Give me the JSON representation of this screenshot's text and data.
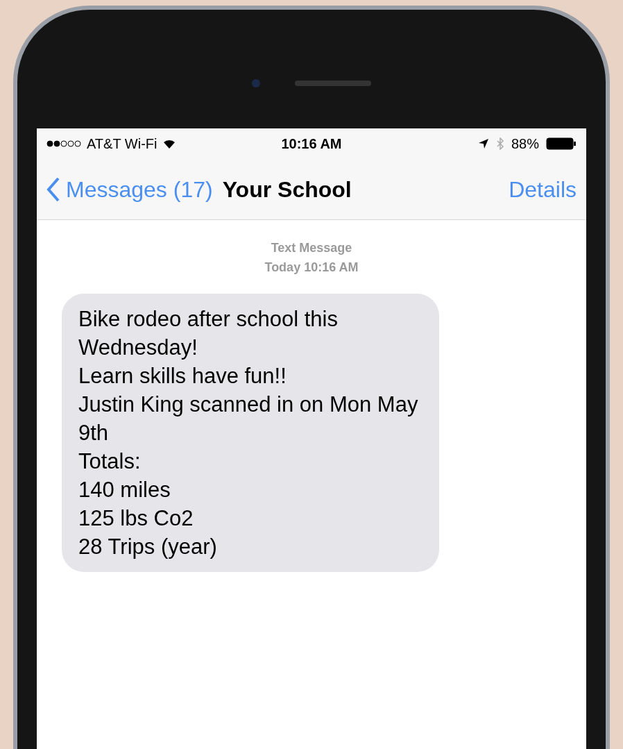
{
  "status_bar": {
    "carrier": "AT&T Wi-Fi",
    "time": "10:16 AM",
    "battery": "88%"
  },
  "nav": {
    "back": "Messages (17)",
    "title": "Your School",
    "action": "Details"
  },
  "thread": {
    "header": "Text Message",
    "timestamp": "Today 10:16 AM",
    "messages": [
      {
        "lines": [
          "Bike rodeo after school this Wednesday!",
          "Learn skills have fun!!",
          "Justin King scanned in on Mon May 9th",
          "Totals:",
          "140 miles",
          "125 lbs Co2",
          "28 Trips (year)"
        ]
      }
    ]
  }
}
